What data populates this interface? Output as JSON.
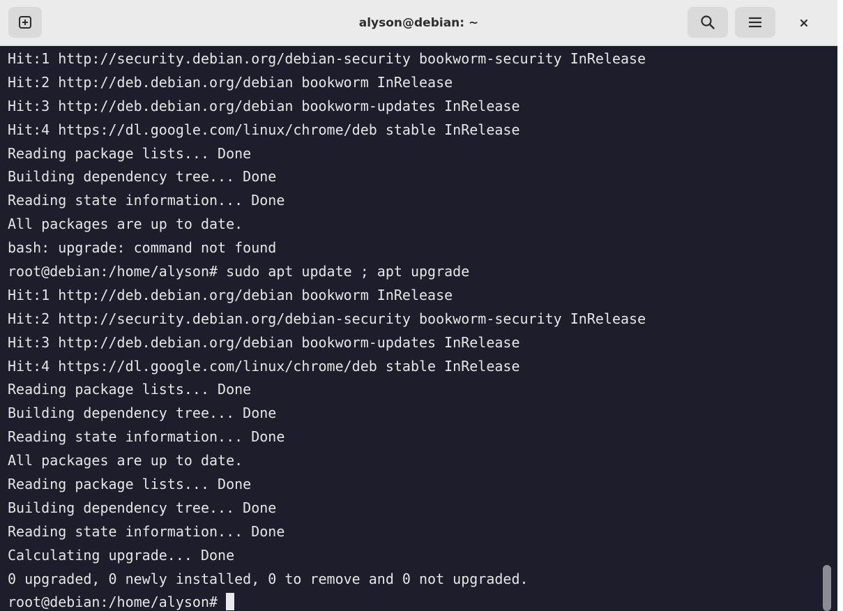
{
  "window": {
    "title": "alyson@debian: ~"
  },
  "header": {
    "new_tab_icon": "plus-square-icon",
    "search_icon": "search-icon",
    "menu_icon": "hamburger-menu-icon",
    "close_icon": "close-icon"
  },
  "terminal": {
    "lines": [
      "Hit:1 http://security.debian.org/debian-security bookworm-security InRelease",
      "Hit:2 http://deb.debian.org/debian bookworm InRelease",
      "Hit:3 http://deb.debian.org/debian bookworm-updates InRelease",
      "Hit:4 https://dl.google.com/linux/chrome/deb stable InRelease",
      "Reading package lists... Done",
      "Building dependency tree... Done",
      "Reading state information... Done",
      "All packages are up to date.",
      "bash: upgrade: command not found",
      "root@debian:/home/alyson# sudo apt update ; apt upgrade",
      "Hit:1 http://deb.debian.org/debian bookworm InRelease",
      "Hit:2 http://security.debian.org/debian-security bookworm-security InRelease",
      "Hit:3 http://deb.debian.org/debian bookworm-updates InRelease",
      "Hit:4 https://dl.google.com/linux/chrome/deb stable InRelease",
      "Reading package lists... Done",
      "Building dependency tree... Done",
      "Reading state information... Done",
      "All packages are up to date.",
      "Reading package lists... Done",
      "Building dependency tree... Done",
      "Reading state information... Done",
      "Calculating upgrade... Done",
      "0 upgraded, 0 newly installed, 0 to remove and 0 not upgraded."
    ],
    "prompt": "root@debian:/home/alyson# "
  },
  "colors": {
    "terminal_bg": "#1d1d2b",
    "terminal_fg": "#e6e6e6",
    "header_bg": "#ebebeb",
    "button_bg": "#dadada"
  }
}
